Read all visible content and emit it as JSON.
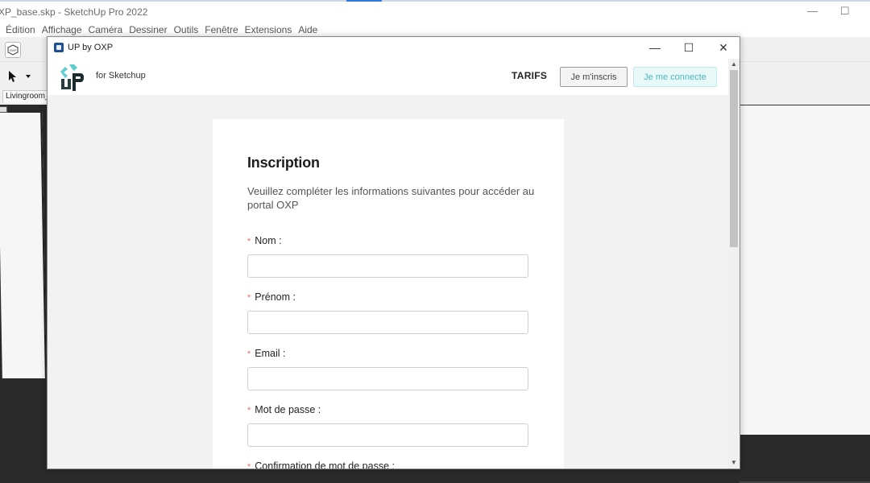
{
  "sketchup": {
    "window_title": "XP_base.skp - SketchUp Pro 2022",
    "menu": [
      "Édition",
      "Affichage",
      "Caméra",
      "Dessiner",
      "Outils",
      "Fenêtre",
      "Extensions",
      "Aide"
    ],
    "scene_tab": "Livingroom_",
    "minimize_icon": "minimize-icon",
    "maximize_icon": "maximize-icon"
  },
  "plugin": {
    "window_title": "UP by OXP",
    "header": {
      "tagline": "for Sketchup",
      "nav_tarifs": "TARIFS",
      "register_label": "Je m'inscris",
      "login_label": "Je me connecte"
    },
    "form": {
      "title": "Inscription",
      "subtitle": "Veuillez compléter les informations suivantes pour accéder au portal OXP",
      "required_marker": "*",
      "fields": [
        {
          "label": "Nom :",
          "value": ""
        },
        {
          "label": "Prénom :",
          "value": ""
        },
        {
          "label": "Email :",
          "value": ""
        },
        {
          "label": "Mot de passe :",
          "value": ""
        },
        {
          "label": "Confirmation de mot de passe :",
          "value": ""
        }
      ]
    }
  },
  "colors": {
    "accent_teal": "#4ab8bd",
    "required_red": "#e66a6a",
    "logo_dark": "#1a2a2e"
  }
}
